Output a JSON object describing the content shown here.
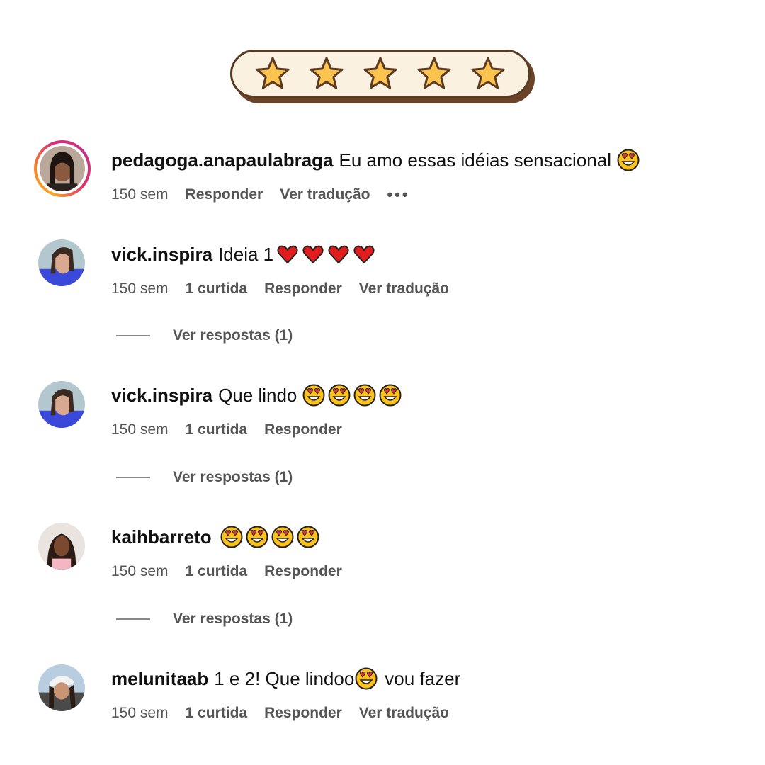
{
  "rating": {
    "stars": 5,
    "filled": 5,
    "star_color": "#fcc34f",
    "star_outline": "#5a3a22"
  },
  "comments": [
    {
      "username": "pedagoga.anapaulabraga",
      "text": "Eu amo essas idéias sensacional",
      "emojis": [
        "heart-eyes"
      ],
      "age": "150 sem",
      "likes": "",
      "reply": "Responder",
      "translate": "Ver tradução",
      "more": "•••",
      "has_story_ring": true
    },
    {
      "username": "vick.inspira",
      "text": "Ideia 1",
      "emojis": [
        "red-heart",
        "red-heart",
        "red-heart",
        "red-heart"
      ],
      "age": "150 sem",
      "likes": "1 curtida",
      "reply": "Responder",
      "translate": "Ver tradução",
      "replies_label": "Ver respostas (1)"
    },
    {
      "username": "vick.inspira",
      "text": "Que lindo",
      "emojis": [
        "heart-eyes",
        "heart-eyes",
        "heart-eyes",
        "heart-eyes"
      ],
      "age": "150 sem",
      "likes": "1 curtida",
      "reply": "Responder",
      "replies_label": "Ver respostas (1)"
    },
    {
      "username": "kaihbarreto",
      "text": "",
      "emojis": [
        "heart-eyes",
        "heart-eyes",
        "heart-eyes",
        "heart-eyes"
      ],
      "age": "150 sem",
      "likes": "1 curtida",
      "reply": "Responder",
      "replies_label": "Ver respostas (1)"
    },
    {
      "username": "melunitaab",
      "text": "1 e 2! Que lindoo",
      "text_after": "vou fazer",
      "emojis": [
        "heart-eyes"
      ],
      "age": "150 sem",
      "likes": "1 curtida",
      "reply": "Responder",
      "translate": "Ver tradução"
    }
  ]
}
